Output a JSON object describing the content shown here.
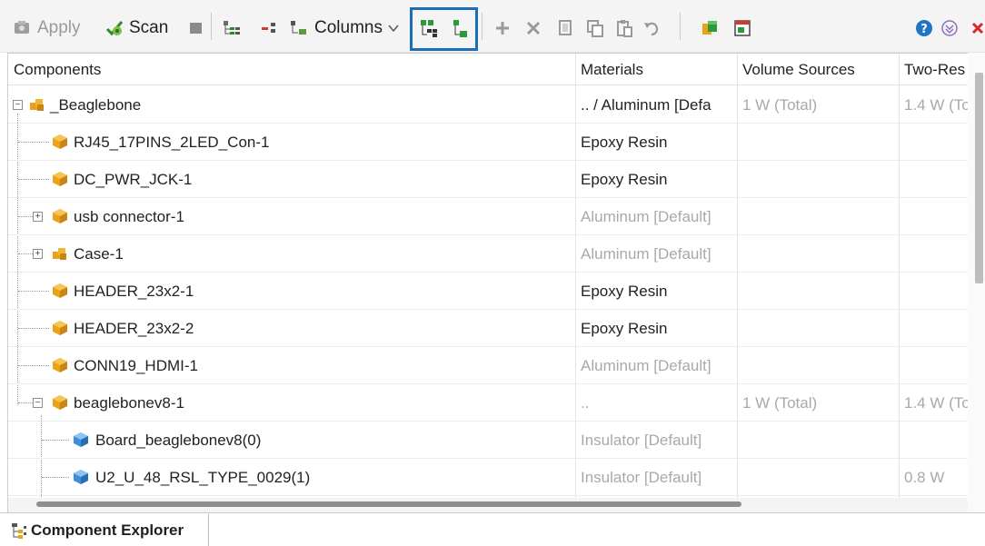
{
  "toolbar": {
    "apply_label": "Apply",
    "scan_label": "Scan",
    "columns_label": "Columns"
  },
  "table": {
    "columns": [
      "Components",
      "Materials",
      "Volume Sources",
      "Two-Res"
    ],
    "rows": [
      {
        "name": "_Beaglebone",
        "material": ".. / Aluminum [Defa",
        "material_grey": false,
        "volume": "1 W (Total)",
        "two_res": "1.4 W (To"
      },
      {
        "name": "RJ45_17PINS_2LED_Con-1",
        "material": "Epoxy Resin",
        "material_grey": false,
        "volume": "",
        "two_res": ""
      },
      {
        "name": "DC_PWR_JCK-1",
        "material": "Epoxy Resin",
        "material_grey": false,
        "volume": "",
        "two_res": ""
      },
      {
        "name": "usb connector-1",
        "material": "Aluminum [Default]",
        "material_grey": true,
        "volume": "",
        "two_res": ""
      },
      {
        "name": "Case-1",
        "material": "Aluminum [Default]",
        "material_grey": true,
        "volume": "",
        "two_res": ""
      },
      {
        "name": "HEADER_23x2-1",
        "material": "Epoxy Resin",
        "material_grey": false,
        "volume": "",
        "two_res": ""
      },
      {
        "name": "HEADER_23x2-2",
        "material": "Epoxy Resin",
        "material_grey": false,
        "volume": "",
        "two_res": ""
      },
      {
        "name": "CONN19_HDMI-1",
        "material": "Aluminum [Default]",
        "material_grey": true,
        "volume": "",
        "two_res": ""
      },
      {
        "name": "beaglebonev8-1",
        "material": "..",
        "material_grey": true,
        "volume": "1 W (Total)",
        "two_res": "1.4 W (To"
      },
      {
        "name": "Board_beaglebonev8(0)",
        "material": "Insulator [Default]",
        "material_grey": true,
        "volume": "",
        "two_res": ""
      },
      {
        "name": "U2_U_48_RSL_TYPE_0029(1)",
        "material": "Insulator [Default]",
        "material_grey": true,
        "volume": "",
        "two_res": "0.8 W"
      }
    ]
  },
  "bottom_tab": {
    "label": "Component Explorer"
  },
  "icons": {
    "apply": "apply-icon",
    "scan": "scan-icon",
    "stop": "stop-icon",
    "add": "add-icon",
    "delete": "delete-icon",
    "copy": "copy-icon",
    "paste": "paste-icon",
    "undo": "undo-icon",
    "help": "help-icon",
    "collapse": "collapse-panel-icon",
    "close": "close-icon"
  },
  "colors": {
    "highlight": "#1a6fb5",
    "cube_orange": "#e9a31b",
    "cube_blue": "#3d8fd8"
  }
}
